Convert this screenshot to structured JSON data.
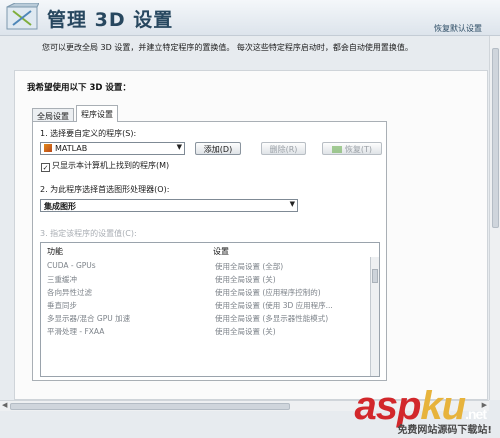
{
  "header": {
    "title": "管理 3D 设置",
    "restore_link": "恢复默认设置"
  },
  "description": "您可以更改全局 3D 设置，并建立特定程序的置换值。 每次这些特定程序启动时，都会自动使用置换值。",
  "panel": {
    "question": "我希望使用以下 3D 设置：",
    "tabs": [
      "全局设置",
      "程序设置"
    ],
    "active_tab": "程序设置",
    "step1_label": "1. 选择要自定义的程序(S):",
    "program_selected": "MATLAB",
    "add_button": "添加(D)",
    "delete_button": "删除(R)",
    "revert_button": "恢复(T)",
    "only_show_checkbox": "只显示本计算机上找到的程序(M)",
    "only_show_checked": true,
    "step2_label": "2. 为此程序选择首选图形处理器(O):",
    "gpu_selected": "集成图形",
    "step3_label": "3. 指定该程序的设置值(C):",
    "grid_headers": {
      "feature": "功能",
      "setting": "设置"
    },
    "grid_rows": [
      {
        "feature": "CUDA - GPUs",
        "setting": "使用全局设置 (全部)"
      },
      {
        "feature": "三重缓冲",
        "setting": "使用全局设置 (关)"
      },
      {
        "feature": "各向异性过滤",
        "setting": "使用全局设置 (应用程序控制的)"
      },
      {
        "feature": "垂直同步",
        "setting": "使用全局设置 (使用 3D 应用程序..."
      },
      {
        "feature": "多显示器/混合 GPU 加速",
        "setting": "使用全局设置 (多显示器性能模式)"
      },
      {
        "feature": "平滑处理 - FXAA",
        "setting": "使用全局设置 (关)"
      }
    ]
  },
  "watermark": {
    "asp": "asp",
    "ku": "ku",
    "net": ".net",
    "subtitle": "免费网站源码下载站!"
  }
}
